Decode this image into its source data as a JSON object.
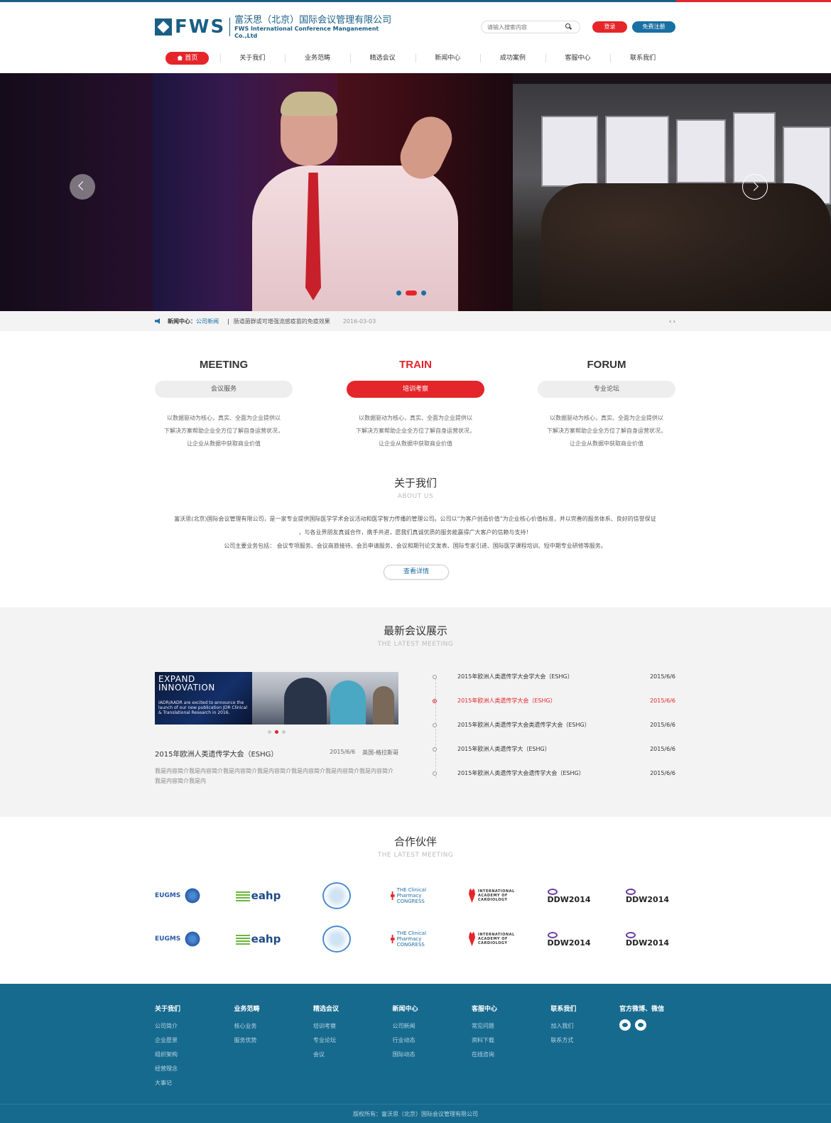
{
  "header": {
    "logo_text": "FWS",
    "company_cn": "富沃思（北京）国际会议管理有限公司",
    "company_en": "FWS International Conference Manganement Co.,Ltd",
    "search_placeholder": "请输入搜索内容",
    "login_label": "登录",
    "register_label": "免费注册"
  },
  "nav": {
    "items": [
      "首页",
      "关于我们",
      "业务范畴",
      "精选会议",
      "新闻中心",
      "成功案例",
      "客服中心",
      "联系我们"
    ],
    "active": "首页"
  },
  "banner": {
    "slide_count": 3,
    "active_slide": 2
  },
  "news": {
    "label": "新闻中心：",
    "category": "公司新闻",
    "separator": "|",
    "title": "肠道菌群或可增强流感疫苗的免疫效果",
    "date": "2016-03-03"
  },
  "services": [
    {
      "en": "MEETING",
      "cn": "会议服务",
      "desc": "以数据驱动为核心，真实、全面为企业提供以\n下解决方案帮助企业全方位了解自身运营状况，\n让企业从数据中获取商业价值",
      "active": false
    },
    {
      "en": "TRAIN",
      "cn": "培训考察",
      "desc": "以数据驱动为核心，真实、全面为企业提供以\n下解决方案帮助企业全方位了解自身运营状况，\n让企业从数据中获取商业价值",
      "active": true
    },
    {
      "en": "FORUM",
      "cn": "专业论坛",
      "desc": "以数据驱动为核心，真实、全面为企业提供以\n下解决方案帮助企业全方位了解自身运营状况，\n让企业从数据中获取商业价值",
      "active": false
    }
  ],
  "about": {
    "title_cn": "关于我们",
    "title_en": "ABOUT US",
    "line1": "富沃思(北京)国际会议管理有限公司，是一家专业提供国际医学学术会议活动和医学智力传播的管理公司。公司以“为客户创造价值”为企业核心价值标准，并以完善的服务体系、良好的信誉保证",
    "line2": "，与各业界朋友真诚合作，携手共进，愿我们真诚优质的服务能赢得广大客户的信赖与支持！",
    "line3": "公司主要业务包括：  会议专项服务、会议商旅接待、会员申请服务、会议和期刊论文发表、国际专家引进、国际医学课程培训、短中期专业研修等服务。",
    "more_label": "查看详情"
  },
  "meetings": {
    "title_cn": "最新会议展示",
    "title_en": "THE LATEST MEETING",
    "image_text_title": "EXPAND\nINNOVATION",
    "image_text_body": "IADR/AADR are excited to announce the launch of our new publication JDR Clinical & Translational Research in 2016.",
    "featured": {
      "title": "2015年欧洲人类遗传学大会（ESHG）",
      "date": "2015/6/6",
      "location": "英国-格拉斯哥",
      "desc": "我是内容简介我是内容简介我是内容简介我是内容简介我是内容简介我是内容简介我是内容简介我是内容简介我是内"
    },
    "list": [
      {
        "title": "2015年欧洲人类遗传学大会学大会（ESHG）",
        "date": "2015/6/6",
        "active": false
      },
      {
        "title": "2015年欧洲人类遗传学大会（ESHG）",
        "date": "2015/6/6",
        "active": true
      },
      {
        "title": "2015年欧洲人类遗传学大会类遗传学大会（ESHG）",
        "date": "2015/6/6",
        "active": false
      },
      {
        "title": "2015年欧洲人类遗传学大（ESHG）",
        "date": "2015/6/6",
        "active": false
      },
      {
        "title": "2015年欧洲人类遗传学大会遗传学大会（ESHG）",
        "date": "2015/6/6",
        "active": false
      }
    ]
  },
  "partners": {
    "title_cn": "合作伙伴",
    "title_en": "THE LATEST MEETING",
    "logos": [
      {
        "name": "eugms-logo",
        "text": "EUGMS"
      },
      {
        "name": "eahp-logo",
        "text": "eahp"
      },
      {
        "name": "circle-emblem-logo",
        "text": ""
      },
      {
        "name": "clinical-pharmacy-logo",
        "text": "THE Clinical Pharmacy CONGRESS"
      },
      {
        "name": "iac-logo",
        "text": "INTERNATIONAL ACADEMY OF CARDIOLOGY"
      },
      {
        "name": "ddw2014-logo",
        "text": "DDW2014"
      },
      {
        "name": "ddw2014-logo-b",
        "text": "DDW2014"
      }
    ]
  },
  "footer": {
    "columns": [
      {
        "title": "关于我们",
        "links": [
          "公司简介",
          "企业愿景",
          "组织架构",
          "经营理念",
          "大事记"
        ]
      },
      {
        "title": "业务范畴",
        "links": [
          "核心业务",
          "服务优势"
        ]
      },
      {
        "title": "精选会议",
        "links": [
          "培训考察",
          "专业论坛",
          "会议"
        ]
      },
      {
        "title": "新闻中心",
        "links": [
          "公司新闻",
          "行业动态",
          "国际动态"
        ]
      },
      {
        "title": "客服中心",
        "links": [
          "常见问题",
          "资料下载",
          "在线咨询"
        ]
      },
      {
        "title": "联系我们",
        "links": [
          "加入我们",
          "联系方式"
        ]
      }
    ],
    "social_title": "官方微博、微信",
    "copyright": "版权所有：富沃思（北京）国际会议管理有限公司"
  },
  "colors": {
    "brand_blue": "#1a5e84",
    "accent_red": "#e4252a",
    "footer_blue": "#166a8e"
  }
}
